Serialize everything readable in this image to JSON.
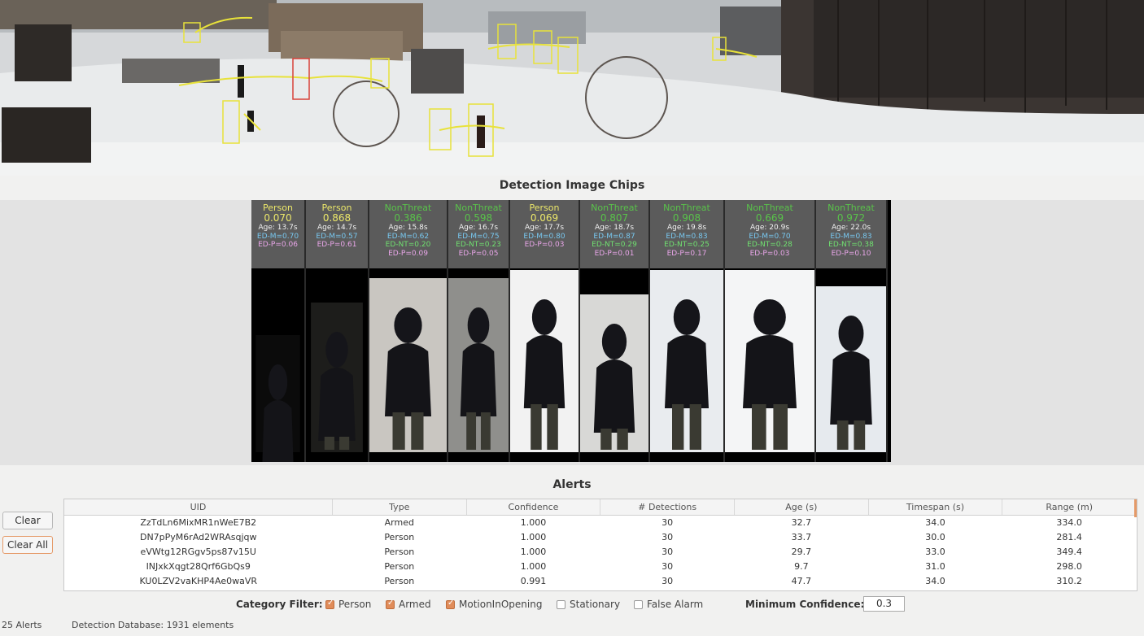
{
  "chips_title": "Detection Image Chips",
  "chips": [
    {
      "label": "Person",
      "score": "0.070",
      "age": "Age: 13.7s",
      "lines": [
        {
          "t": "ED-M=0.70",
          "c": "edm"
        },
        {
          "t": "ED-P=0.06",
          "c": "edp"
        }
      ]
    },
    {
      "label": "Person",
      "score": "0.868",
      "age": "Age: 14.7s",
      "lines": [
        {
          "t": "ED-M=0.57",
          "c": "edm"
        },
        {
          "t": "ED-P=0.61",
          "c": "edp"
        }
      ]
    },
    {
      "label": "NonThreat",
      "score": "0.386",
      "age": "Age: 15.8s",
      "lines": [
        {
          "t": "ED-M=0.62",
          "c": "edm"
        },
        {
          "t": "ED-NT=0.20",
          "c": "ednt"
        },
        {
          "t": "ED-P=0.09",
          "c": "edp"
        }
      ]
    },
    {
      "label": "NonThreat",
      "score": "0.598",
      "age": "Age: 16.7s",
      "lines": [
        {
          "t": "ED-M=0.75",
          "c": "edm"
        },
        {
          "t": "ED-NT=0.23",
          "c": "ednt"
        },
        {
          "t": "ED-P=0.05",
          "c": "edp"
        }
      ]
    },
    {
      "label": "Person",
      "score": "0.069",
      "age": "Age: 17.7s",
      "lines": [
        {
          "t": "ED-M=0.80",
          "c": "edm"
        },
        {
          "t": "ED-P=0.03",
          "c": "edp"
        }
      ]
    },
    {
      "label": "NonThreat",
      "score": "0.807",
      "age": "Age: 18.7s",
      "lines": [
        {
          "t": "ED-M=0.87",
          "c": "edm"
        },
        {
          "t": "ED-NT=0.29",
          "c": "ednt"
        },
        {
          "t": "ED-P=0.01",
          "c": "edp"
        }
      ]
    },
    {
      "label": "NonThreat",
      "score": "0.908",
      "age": "Age: 19.8s",
      "lines": [
        {
          "t": "ED-M=0.83",
          "c": "edm"
        },
        {
          "t": "ED-NT=0.25",
          "c": "ednt"
        },
        {
          "t": "ED-P=0.17",
          "c": "edp"
        }
      ]
    },
    {
      "label": "NonThreat",
      "score": "0.669",
      "age": "Age: 20.9s",
      "lines": [
        {
          "t": "ED-M=0.70",
          "c": "edm"
        },
        {
          "t": "ED-NT=0.28",
          "c": "ednt"
        },
        {
          "t": "ED-P=0.03",
          "c": "edp"
        }
      ]
    },
    {
      "label": "NonThreat",
      "score": "0.972",
      "age": "Age: 22.0s",
      "lines": [
        {
          "t": "ED-M=0.83",
          "c": "edm"
        },
        {
          "t": "ED-NT=0.38",
          "c": "ednt"
        },
        {
          "t": "ED-P=0.10",
          "c": "edp"
        }
      ]
    }
  ],
  "alerts_title": "Alerts",
  "buttons": {
    "clear": "Clear",
    "clear_all": "Clear All"
  },
  "table": {
    "columns": [
      "UID",
      "Type",
      "Confidence",
      "# Detections",
      "Age (s)",
      "Timespan (s)",
      "Range (m)"
    ],
    "rows": [
      [
        "ZzTdLn6MixMR1nWeE7B2",
        "Armed",
        "1.000",
        "30",
        "32.7",
        "34.0",
        "334.0"
      ],
      [
        "DN7pPyM6rAd2WRAsqjqw",
        "Person",
        "1.000",
        "30",
        "33.7",
        "30.0",
        "281.4"
      ],
      [
        "eVWtg12RGgv5ps87v15U",
        "Person",
        "1.000",
        "30",
        "29.7",
        "33.0",
        "349.4"
      ],
      [
        "INJxkXqgt28Qrf6GbQs9",
        "Person",
        "1.000",
        "30",
        "9.7",
        "31.0",
        "298.0"
      ],
      [
        "KU0LZV2vaKHP4Ae0waVR",
        "Person",
        "0.991",
        "30",
        "47.7",
        "34.0",
        "310.2"
      ]
    ]
  },
  "filter": {
    "label": "Category Filter:",
    "options": [
      {
        "label": "Person",
        "checked": true
      },
      {
        "label": "Armed",
        "checked": true
      },
      {
        "label": "MotionInOpening",
        "checked": true
      },
      {
        "label": "Stationary",
        "checked": false
      },
      {
        "label": "False Alarm",
        "checked": false
      }
    ],
    "min_conf_label": "Minimum Confidence:",
    "min_conf_value": "0.3"
  },
  "status": {
    "alerts": "25 Alerts",
    "database": "Detection Database: 1931 elements"
  },
  "colors": {
    "accent": "#e08c5a",
    "chip_header": "#5b5b5b",
    "person_label": "#ece86a",
    "nonthreat_label": "#59c34a"
  }
}
